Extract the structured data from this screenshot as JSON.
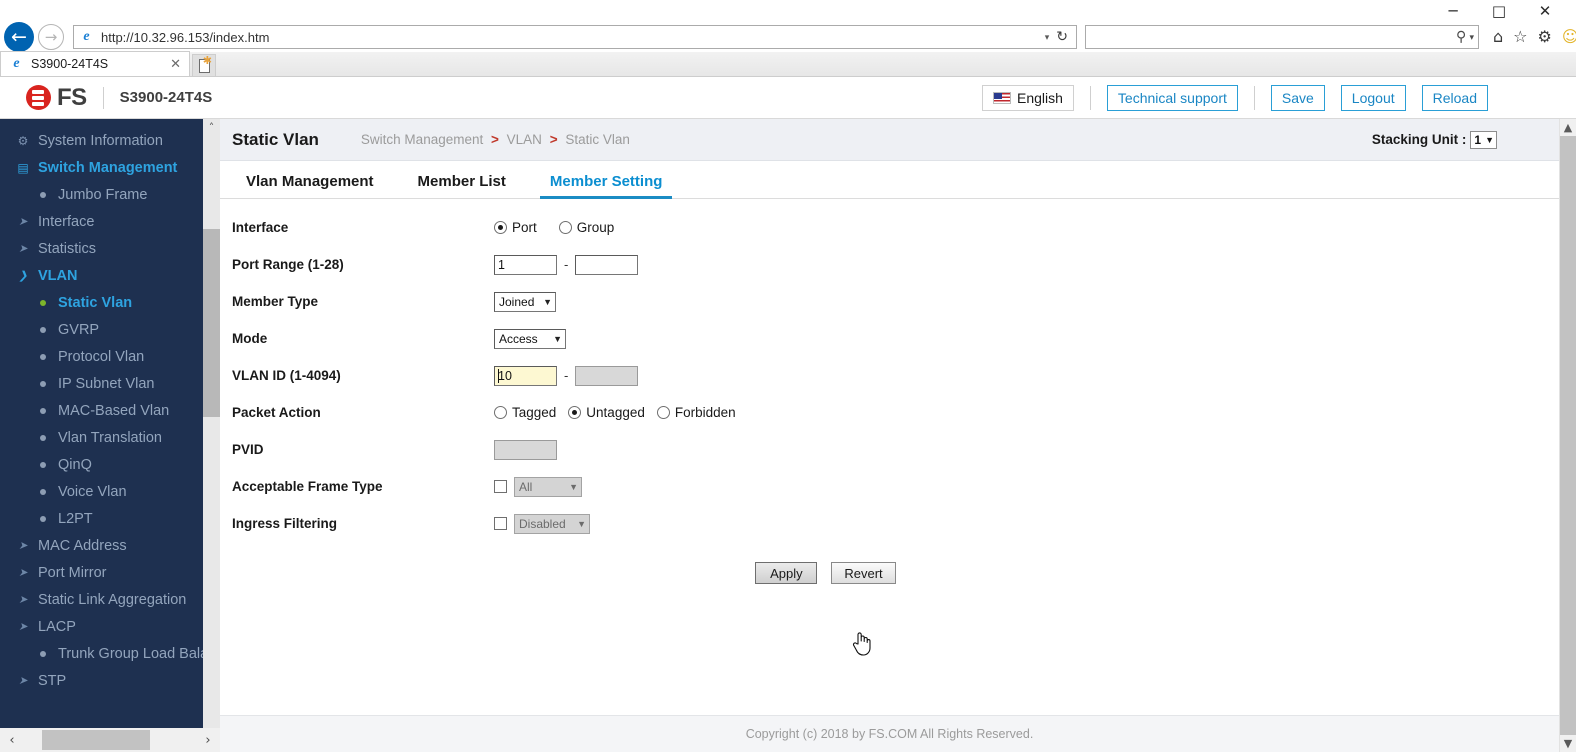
{
  "browser": {
    "window_controls": {
      "minimize": "─",
      "maximize": "□",
      "close": "✕"
    },
    "back_icon": "←",
    "forward_icon": "→",
    "url": "http://10.32.96.153/index.htm",
    "url_dropdown_icon": "▾",
    "reload_icon": "↻",
    "search_placeholder": "",
    "search_icon": "⚲",
    "search_dropdown_icon": "▾",
    "home_icon": "⌂",
    "favorites_icon": "☆",
    "settings_icon": "⚙",
    "smiley_icon": "☺",
    "tab_title": "S3900-24T4S",
    "tab_close_icon": "✕",
    "new_tab_label": "New tab"
  },
  "header": {
    "brand": "FS",
    "model": "S3900-24T4S",
    "language": "English",
    "technical_support": "Technical support",
    "save": "Save",
    "logout": "Logout",
    "reload": "Reload"
  },
  "page": {
    "title": "Static Vlan",
    "breadcrumb": [
      "Switch Management",
      "VLAN",
      "Static Vlan"
    ],
    "breadcrumb_separator": ">",
    "stacking_unit_label": "Stacking Unit :",
    "stacking_unit_value": "1"
  },
  "tabs": [
    {
      "label": "Vlan Management",
      "active": false
    },
    {
      "label": "Member List",
      "active": false
    },
    {
      "label": "Member Setting",
      "active": true
    }
  ],
  "form": {
    "interface": {
      "label": "Interface",
      "options": [
        "Port",
        "Group"
      ],
      "selected": "Port"
    },
    "port_range": {
      "label": "Port Range (1-28)",
      "from": "1",
      "to": "",
      "separator": "-"
    },
    "member_type": {
      "label": "Member Type",
      "value": "Joined"
    },
    "mode": {
      "label": "Mode",
      "value": "Access"
    },
    "vlan_id": {
      "label": "VLAN ID (1-4094)",
      "from": "10",
      "to": "",
      "separator": "-"
    },
    "packet_action": {
      "label": "Packet Action",
      "options": [
        "Tagged",
        "Untagged",
        "Forbidden"
      ],
      "selected": "Untagged"
    },
    "pvid": {
      "label": "PVID",
      "value": ""
    },
    "acceptable_frame_type": {
      "label": "Acceptable Frame Type",
      "checked": false,
      "value": "All"
    },
    "ingress_filtering": {
      "label": "Ingress Filtering",
      "checked": false,
      "value": "Disabled"
    },
    "apply_button": "Apply",
    "revert_button": "Revert"
  },
  "sidebar": {
    "items": [
      {
        "label": "System Information",
        "level": 1,
        "icon": "gear-icon",
        "active": false
      },
      {
        "label": "Switch Management",
        "level": 1,
        "icon": "switch-icon",
        "active": true
      },
      {
        "label": "Jumbo Frame",
        "level": 2,
        "icon": "dot-icon",
        "active": false
      },
      {
        "label": "Interface",
        "level": 1,
        "icon": "chevron-right-icon",
        "active": false
      },
      {
        "label": "Statistics",
        "level": 1,
        "icon": "chevron-right-icon",
        "active": false
      },
      {
        "label": "VLAN",
        "level": 1,
        "icon": "chevron-down-icon",
        "active": true
      },
      {
        "label": "Static Vlan",
        "level": 2,
        "icon": "dot-green-icon",
        "active": true
      },
      {
        "label": "GVRP",
        "level": 2,
        "icon": "dot-icon",
        "active": false
      },
      {
        "label": "Protocol Vlan",
        "level": 2,
        "icon": "dot-icon",
        "active": false
      },
      {
        "label": "IP Subnet Vlan",
        "level": 2,
        "icon": "dot-icon",
        "active": false
      },
      {
        "label": "MAC-Based Vlan",
        "level": 2,
        "icon": "dot-icon",
        "active": false
      },
      {
        "label": "Vlan Translation",
        "level": 2,
        "icon": "dot-icon",
        "active": false
      },
      {
        "label": "QinQ",
        "level": 2,
        "icon": "dot-icon",
        "active": false
      },
      {
        "label": "Voice Vlan",
        "level": 2,
        "icon": "dot-icon",
        "active": false
      },
      {
        "label": "L2PT",
        "level": 2,
        "icon": "dot-icon",
        "active": false
      },
      {
        "label": "MAC Address",
        "level": 1,
        "icon": "chevron-right-icon",
        "active": false
      },
      {
        "label": "Port Mirror",
        "level": 1,
        "icon": "chevron-right-icon",
        "active": false
      },
      {
        "label": "Static Link Aggregation",
        "level": 1,
        "icon": "chevron-right-icon",
        "active": false
      },
      {
        "label": "LACP",
        "level": 1,
        "icon": "chevron-right-icon",
        "active": false
      },
      {
        "label": "Trunk Group Load Balance",
        "level": 2,
        "icon": "dot-icon",
        "active": false
      },
      {
        "label": "STP",
        "level": 1,
        "icon": "chevron-right-icon",
        "active": false
      }
    ],
    "scroll_up_icon": "˄",
    "scroll_down_icon": "˅",
    "hscroll_left_icon": "‹",
    "hscroll_right_icon": "›"
  },
  "footer": {
    "copyright": "Copyright (c) 2018 by FS.COM All Rights Reserved."
  },
  "colors": {
    "sidebar_bg": "#1e3050",
    "accent_blue": "#0b8ed0",
    "brand_red": "#d9241f",
    "focus_field": "#fdf8d2"
  }
}
